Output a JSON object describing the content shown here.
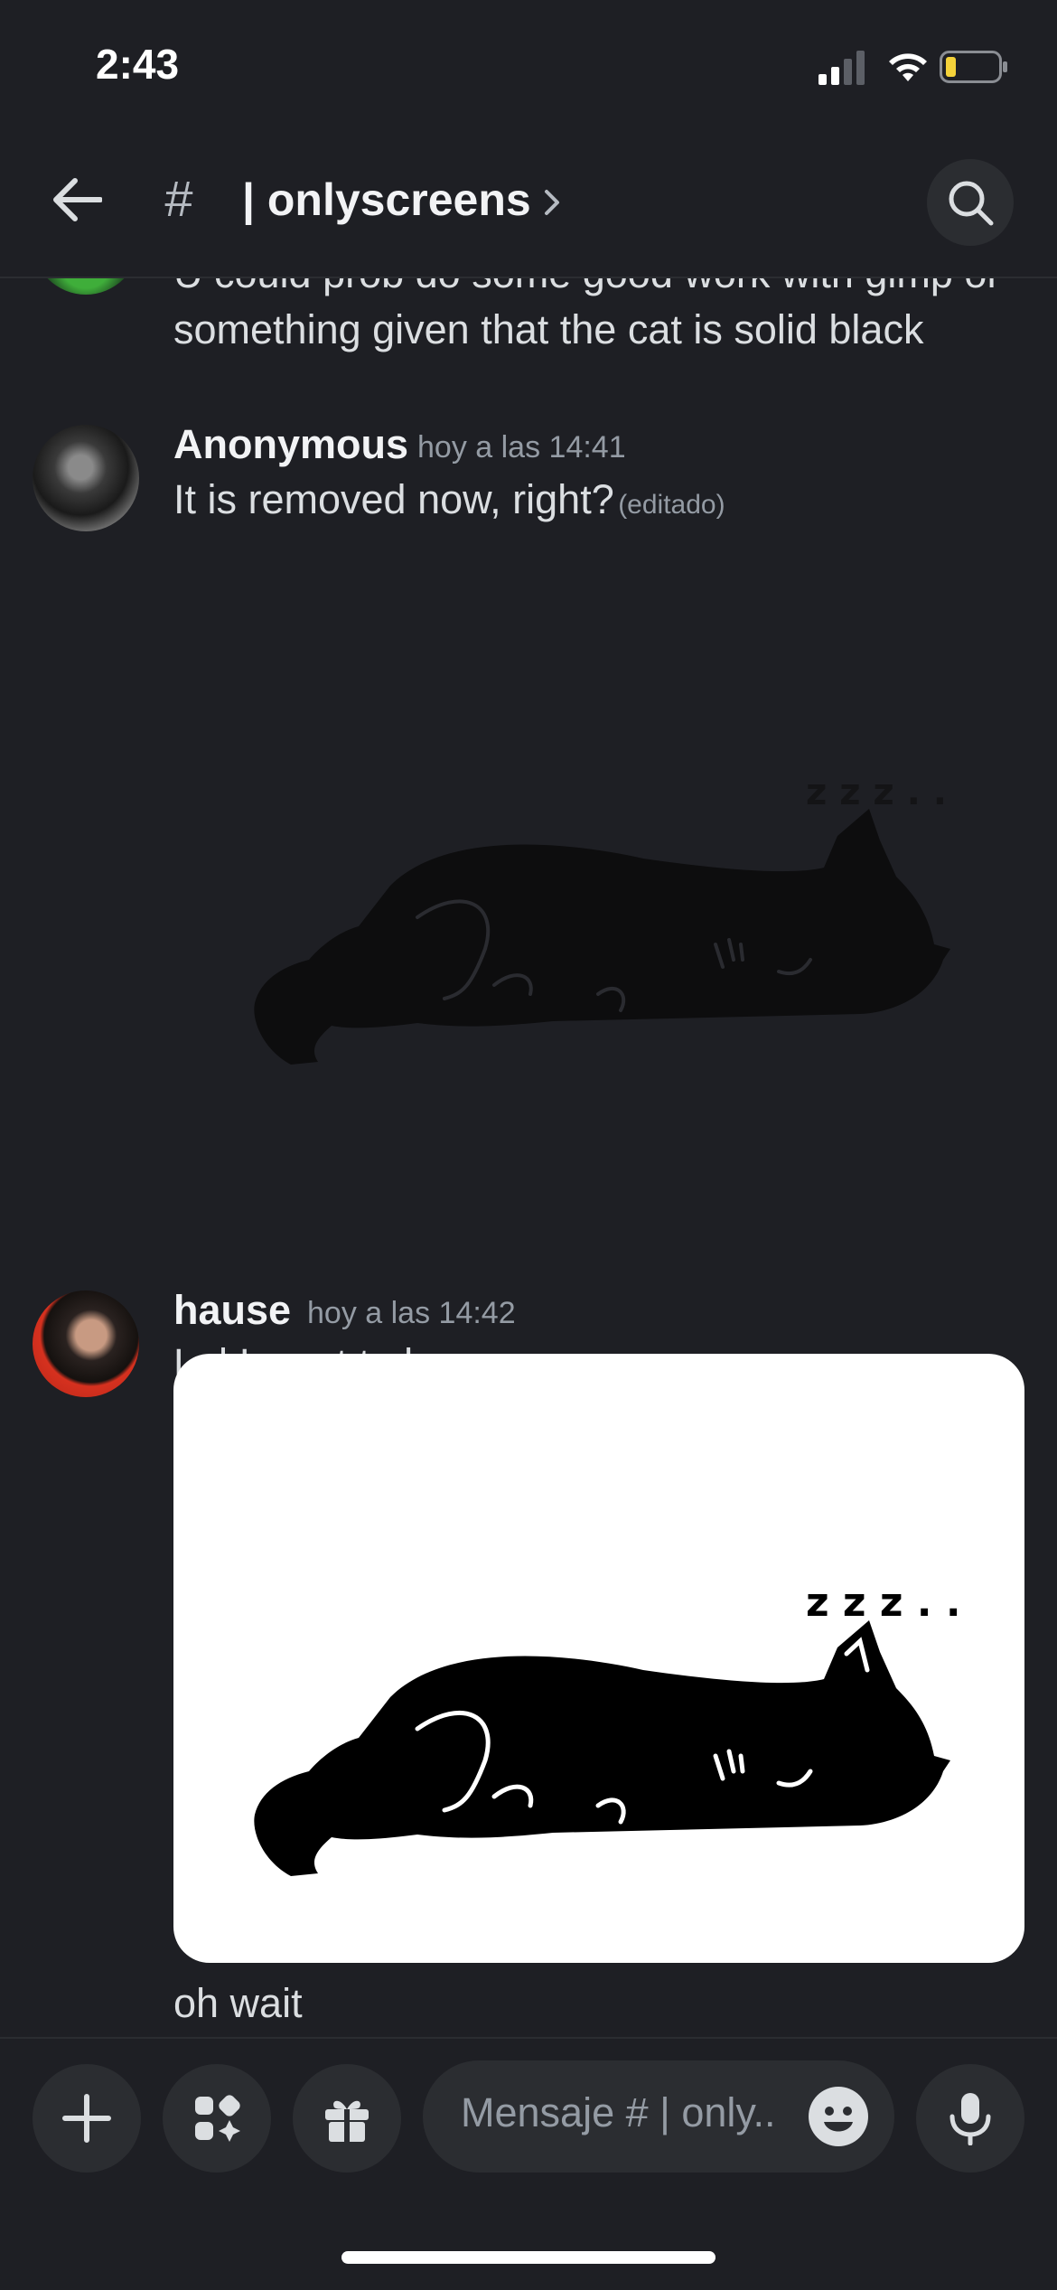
{
  "status_bar": {
    "time": "2:43"
  },
  "header": {
    "channel_hash": "#",
    "channel_name": "| onlyscreens"
  },
  "messages": {
    "cutoff_line1": "U could prob do some good work with gimp or",
    "cutoff_line2": "something given that the cat is solid black",
    "m1": {
      "author": "Anonymous",
      "timestamp": "hoy a las 14:41",
      "text": "It is removed now, right?",
      "edited": "(editado)",
      "followup": "Lol I want to be sure"
    },
    "m2": {
      "author": "hause",
      "timestamp": "hoy a las 14:42",
      "image_caption": "z z z . .",
      "followup": "oh wait"
    }
  },
  "composer": {
    "placeholder": "Mensaje # | only.."
  },
  "icons": [
    "back-arrow-icon",
    "hash-icon",
    "chevron-right-icon",
    "search-icon",
    "plus-icon",
    "apps-icon",
    "gift-icon",
    "emoji-icon",
    "microphone-icon"
  ]
}
